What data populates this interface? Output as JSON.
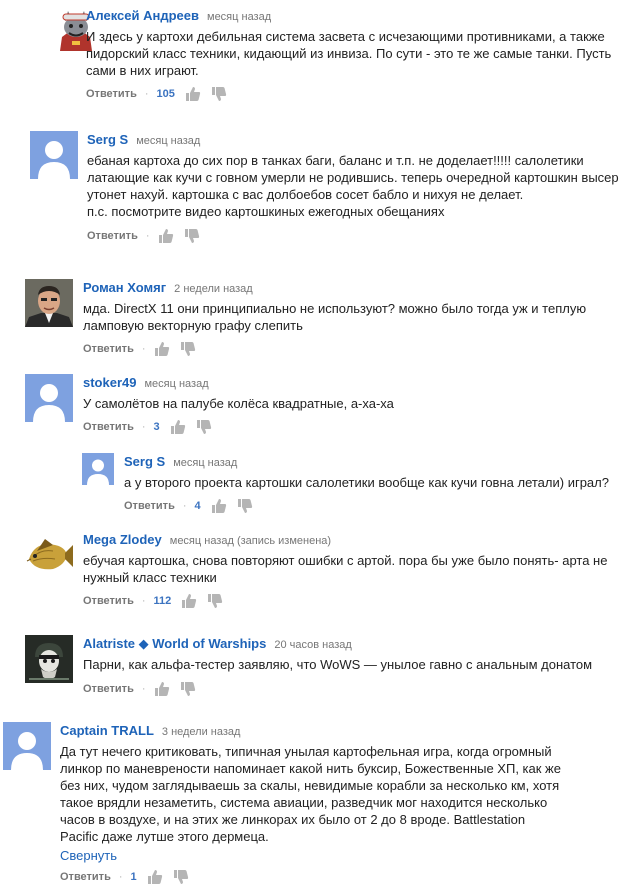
{
  "ui": {
    "reply_label": "Ответить",
    "separator": "·",
    "collapse_label": "Свернуть"
  },
  "comments": [
    {
      "author": "Алексей Андреев",
      "time": "месяц назад",
      "text": "И здесь у картохи дебильная система засвета с исчезающими противниками, а также\nпидорский класс техники, кидающий из инвиза. По сути - это те же самые танки. Пусть\nсами в них играют.",
      "likes": "105",
      "avatar": "wolf-avatar"
    },
    {
      "author": "Serg S",
      "time": "месяц назад",
      "text": "ебаная картоха до сих пор в танках баги, баланс и т.п. не доделает!!!!! салолетики\nлатающие как кучи с говном умерли не родившись. теперь очередной картошкин высер\nутонет нахуй. картошка с вас долбоебов сосет бабло и нихуя не делает.\nп.с. посмотрите видео картошкиных ежегодных обещаниях",
      "likes": "",
      "avatar": "default-avatar"
    },
    {
      "author": "Роман Хомяг",
      "time": "2 недели назад",
      "text": "мда. DirectX 11 они принципиально не используют? можно было тогда уж и теплую\nламповую векторную графу слепить",
      "likes": "",
      "avatar": "man-avatar"
    },
    {
      "author": "stoker49",
      "time": "месяц назад",
      "text": "У самолётов на палубе колёса квадратные, а-ха-ха",
      "likes": "3",
      "avatar": "default-avatar"
    },
    {
      "author": "Serg S",
      "time": "месяц назад",
      "text": "а у второго проекта картошки салолетики вообще как кучи говна летали) играл?",
      "likes": "4",
      "avatar": "default-avatar",
      "is_reply": true
    },
    {
      "author": "Mega Zlodey",
      "time": "месяц назад (запись изменена)",
      "text": "ебучая картошка, снова повторяют ошибки с артой. пора бы уже было понять- арта не\nнужный класс техники",
      "likes": "112",
      "avatar": "fish-avatar"
    },
    {
      "author": "Alatriste ◆ World of Warships",
      "time": "20 часов назад",
      "text": "Парни, как альфа-тестер заявляю, что WoWS — унылое гавно с анальным донатом",
      "likes": "",
      "avatar": "pirate-avatar"
    },
    {
      "author": "Captain TRALL",
      "time": "3 недели назад",
      "text": "Да тут нечего критиковать, типичная унылая картофельная игра, когда огромный\nлинкор по маневрености напоминает какой нить буксир, Божественные ХП, как же\nбез них, чудом заглядываешь за скалы, невидимые корабли за несколько км, хотя\nтакое врядли незаметить, система авиации, разведчик мог находится несколько\nчасов в воздухе, и на этих же линкорах их было от 2 до 8 вроде.  Battlestation\nPacific даже лутше этого дермеца.",
      "likes": "1",
      "avatar": "default-avatar"
    }
  ]
}
